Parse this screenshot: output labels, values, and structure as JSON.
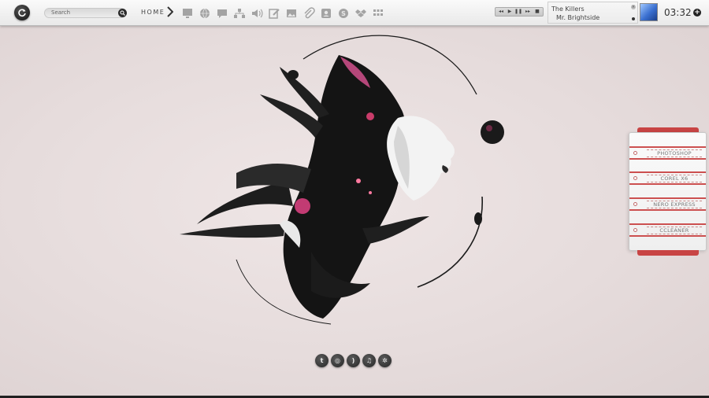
{
  "search": {
    "placeholder": "Search"
  },
  "nav": {
    "home_label": "HOME"
  },
  "launcher_icons": [
    "monitor-icon",
    "globe-icon",
    "chat-icon",
    "network-icon",
    "volume-icon",
    "edit-icon",
    "image-icon",
    "attach-icon",
    "contact-icon",
    "skype-icon",
    "dropbox-icon",
    "grid-icon"
  ],
  "media": {
    "controls": [
      "rewind-icon",
      "play-icon",
      "pause-icon",
      "forward-icon",
      "stop-icon"
    ],
    "artist": "The Killers",
    "track": "Mr. Brightside"
  },
  "clock": "03:32",
  "dock": {
    "items": [
      "PHOTOSHOP",
      "COREL X6",
      "NERO EXPRESS",
      "CCLEANER"
    ]
  },
  "social": [
    "twitter-icon",
    "dribbble-icon",
    "rss-icon",
    "music-icon",
    "settings-icon"
  ],
  "colors": {
    "accent": "#c84444",
    "bar": "#efefef",
    "icon_gray": "#9a9a9a"
  }
}
